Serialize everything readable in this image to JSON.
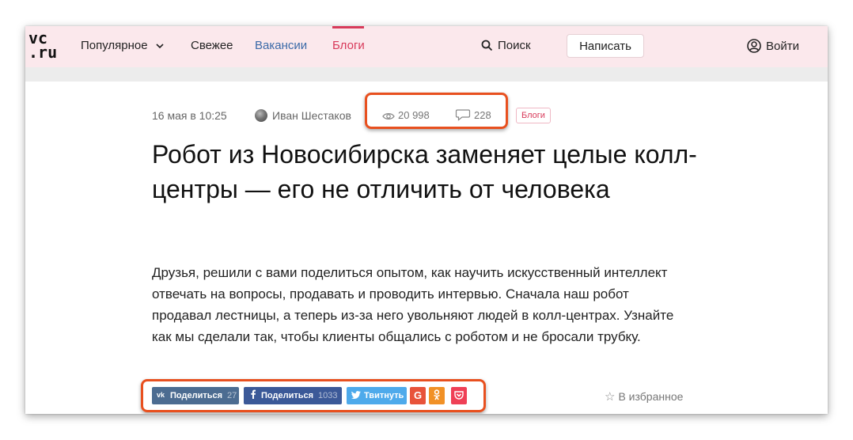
{
  "header": {
    "logo": {
      "line1": "vc",
      "line2": ".ru"
    },
    "nav": {
      "popular": "Популярное",
      "fresh": "Свежее",
      "vacancies": "Вакансии",
      "blogs": "Блоги"
    },
    "search_label": "Поиск",
    "write_button": "Написать",
    "login_label": "Войти"
  },
  "article": {
    "date": "16 мая в 10:25",
    "author": "Иван Шестаков",
    "views": "20 998",
    "comments": "228",
    "tag": "Блоги",
    "title": "Робот из Новосибирска заменяет целые колл-центры — его не отличить от человека",
    "lead": "Друзья, решили с вами поделиться опытом, как научить искусственный интеллект отвечать на вопросы, продавать и проводить интервью. Сначала наш робот продавал лестницы, а теперь из-за него увольняют людей в колл-центрах. Узнайте как мы сделали так, чтобы клиенты общались с роботом и не бросали трубку."
  },
  "share": {
    "vk": {
      "label": "Поделиться",
      "count": "27"
    },
    "facebook": {
      "label": "Поделиться",
      "count": "1033"
    },
    "twitter": {
      "label": "Твитнуть"
    }
  },
  "favorite_label": "В избранное",
  "colors": {
    "header_bg": "#fbe8ec",
    "accent_pink": "#d83a5a",
    "vacancies_blue": "#3b6aa8",
    "highlight_orange": "#e8501f",
    "vk": "#4c6c91",
    "facebook": "#3b5998",
    "twitter": "#4eaaeb",
    "google": "#e8533a",
    "odnoklassniki": "#f19126",
    "pocket": "#ef4056"
  },
  "icons": [
    "chevron-down-icon",
    "search-icon",
    "user-icon",
    "eye-icon",
    "comment-icon",
    "vk-icon",
    "facebook-icon",
    "twitter-icon",
    "google-icon",
    "odnoklassniki-icon",
    "pocket-icon",
    "star-icon"
  ]
}
